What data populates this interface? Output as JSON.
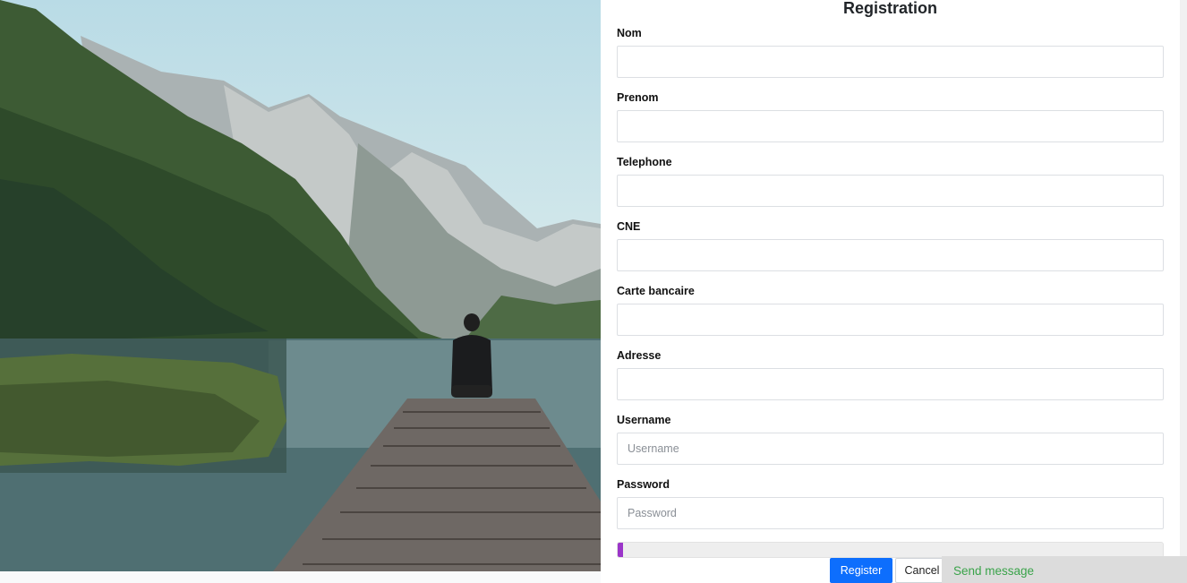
{
  "hero": {
    "image": "mountain-lake-dock-photo"
  },
  "form": {
    "title": "Registration",
    "fields": [
      {
        "label": "Nom",
        "value": "",
        "placeholder": ""
      },
      {
        "label": "Prenom",
        "value": "",
        "placeholder": ""
      },
      {
        "label": "Telephone",
        "value": "",
        "placeholder": ""
      },
      {
        "label": "CNE",
        "value": "",
        "placeholder": ""
      },
      {
        "label": "Carte bancaire",
        "value": "",
        "placeholder": ""
      },
      {
        "label": "Adresse",
        "value": "",
        "placeholder": ""
      },
      {
        "label": "Username",
        "value": "",
        "placeholder": "Username"
      },
      {
        "label": "Password",
        "value": "",
        "placeholder": "Password"
      }
    ],
    "progress": {
      "percent": 1,
      "color": "#9b35c9"
    },
    "register_label": "Register",
    "cancel_label": "Cancel"
  },
  "chat_widget": {
    "label": "Send message",
    "color": "#3aa34a"
  },
  "colors": {
    "primary": "#0d6efd"
  }
}
